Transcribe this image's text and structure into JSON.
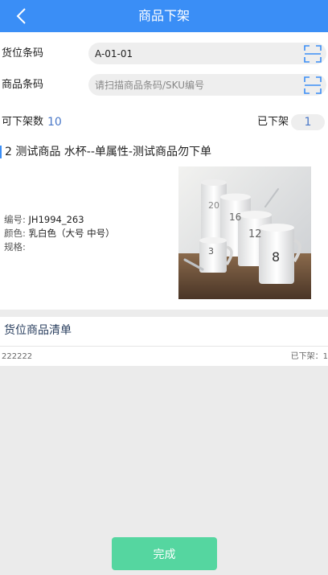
{
  "header": {
    "title": "商品下架",
    "back_icon": "chevron-left-icon"
  },
  "form": {
    "location_barcode": {
      "label": "货位条码",
      "value": "A-01-01"
    },
    "product_barcode": {
      "label": "商品条码",
      "value": "",
      "placeholder": "请扫描商品条码/SKU编号"
    },
    "scan_icon": "scan-icon"
  },
  "counts": {
    "available_label": "可下架数",
    "available_value": "10",
    "removed_label": "已下架",
    "removed_value": "1"
  },
  "product": {
    "title": "2 测试商品 水杯--单属性-测试商品勿下单",
    "code_label": "编号:",
    "code_value": "JH1994_263",
    "color_label": "颜色:",
    "color_value": "乳白色（大号 中号）",
    "spec_label": "规格:",
    "spec_value": "",
    "image_alt": "mugs"
  },
  "list": {
    "header": "货位商品清单",
    "rows": [
      {
        "code": "222222",
        "status": "已下架：1"
      }
    ]
  },
  "footer": {
    "finish_label": "完成"
  },
  "colors": {
    "primary": "#3a8ef6",
    "accent": "#55d6a0",
    "number": "#4a78c8"
  }
}
